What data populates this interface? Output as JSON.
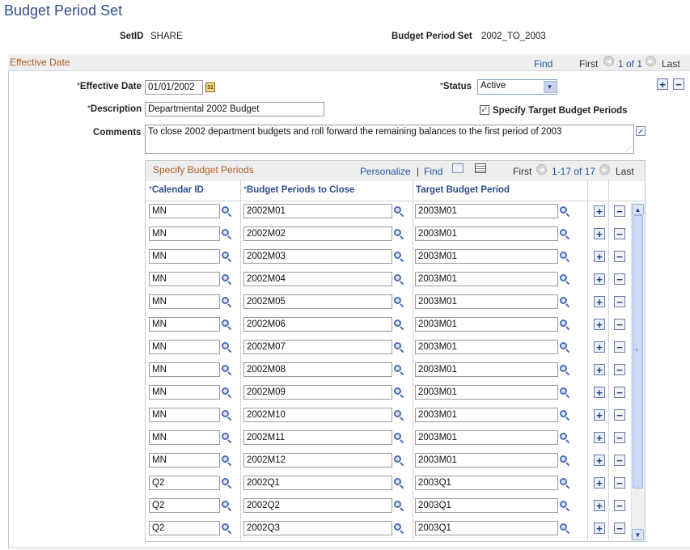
{
  "page": {
    "title": "Budget Period Set"
  },
  "header": {
    "setid_label": "SetID",
    "setid_value": "SHARE",
    "bps_label": "Budget Period Set",
    "bps_value": "2002_TO_2003"
  },
  "effective_date_section": {
    "title": "Effective Date",
    "find": "Find",
    "first": "First",
    "range": "1 of 1",
    "last": "Last",
    "effdt_label": "Effective Date",
    "effdt_value": "01/01/2002",
    "status_label": "Status",
    "status_value": "Active",
    "description_label": "Description",
    "description_value": "Departmental 2002 Budget",
    "specify_label": "Specify Target Budget Periods",
    "specify_checked": true,
    "comments_label": "Comments",
    "comments_value": "To close 2002 department budgets and roll forward the remaining balances to the first period of 2003",
    "required_mark": "*"
  },
  "grid": {
    "title": "Specify Budget Periods",
    "personalize": "Personalize",
    "find": "Find",
    "separator": "|",
    "first": "First",
    "range": "1-17 of 17",
    "last": "Last",
    "columns": {
      "calendar": "Calendar ID",
      "periods": "Budget Periods to Close",
      "target": "Target Budget Period"
    },
    "rows": [
      {
        "cal": "MN",
        "period": "2002M01",
        "target": "2003M01"
      },
      {
        "cal": "MN",
        "period": "2002M02",
        "target": "2003M01"
      },
      {
        "cal": "MN",
        "period": "2002M03",
        "target": "2003M01"
      },
      {
        "cal": "MN",
        "period": "2002M04",
        "target": "2003M01"
      },
      {
        "cal": "MN",
        "period": "2002M05",
        "target": "2003M01"
      },
      {
        "cal": "MN",
        "period": "2002M06",
        "target": "2003M01"
      },
      {
        "cal": "MN",
        "period": "2002M07",
        "target": "2003M01"
      },
      {
        "cal": "MN",
        "period": "2002M08",
        "target": "2003M01"
      },
      {
        "cal": "MN",
        "period": "2002M09",
        "target": "2003M01"
      },
      {
        "cal": "MN",
        "period": "2002M10",
        "target": "2003M01"
      },
      {
        "cal": "MN",
        "period": "2002M11",
        "target": "2003M01"
      },
      {
        "cal": "MN",
        "period": "2002M12",
        "target": "2003M01"
      },
      {
        "cal": "Q2",
        "period": "2002Q1",
        "target": "2003Q1"
      },
      {
        "cal": "Q2",
        "period": "2002Q2",
        "target": "2003Q1"
      },
      {
        "cal": "Q2",
        "period": "2002Q3",
        "target": "2003Q1"
      }
    ]
  },
  "colors": {
    "title_blue": "#2f4f86",
    "section_orange": "#b35c22",
    "link_blue": "#2055a7"
  }
}
